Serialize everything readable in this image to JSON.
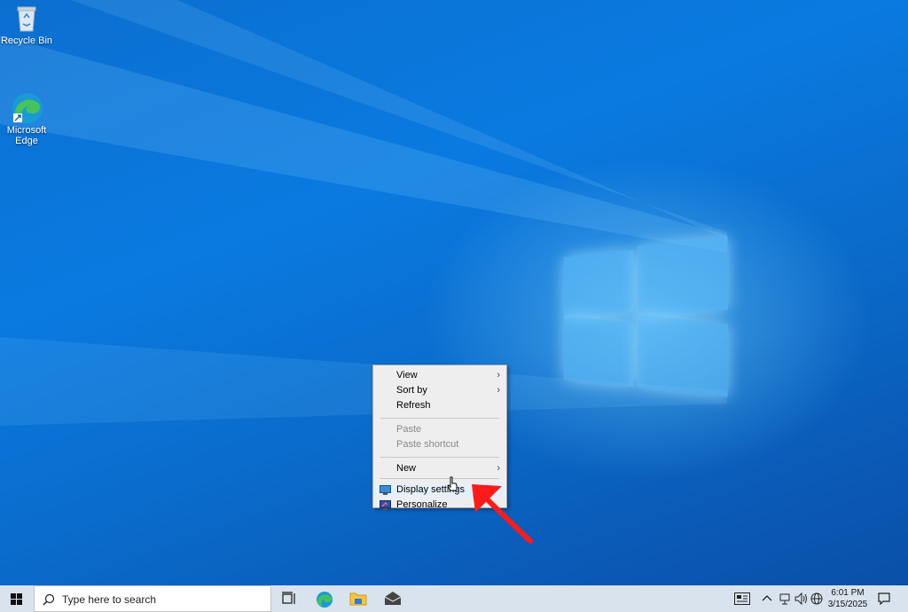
{
  "desktop": {
    "icons": [
      {
        "label": "Recycle Bin",
        "icon": "recycle-bin-icon"
      },
      {
        "label": "Microsoft\nEdge",
        "icon": "edge-icon"
      }
    ]
  },
  "context_menu": {
    "items": {
      "view": "View",
      "sort_by": "Sort by",
      "refresh": "Refresh",
      "paste": "Paste",
      "paste_shortcut": "Paste shortcut",
      "new": "New",
      "display_settings": "Display settings",
      "personalize": "Personalize"
    },
    "submenu_arrow": "›"
  },
  "taskbar": {
    "search_placeholder": "Type here to search",
    "pinned_apps": [
      "task-view-icon",
      "edge-icon",
      "file-explorer-icon",
      "mail-icon"
    ],
    "clock_time": "6:01 PM",
    "clock_date": "3/15/2025"
  },
  "colors": {
    "desktop_blue": "#0a7ae0",
    "taskbar": "#d9e3ee",
    "annotation_arrow": "#ff1a1a"
  }
}
